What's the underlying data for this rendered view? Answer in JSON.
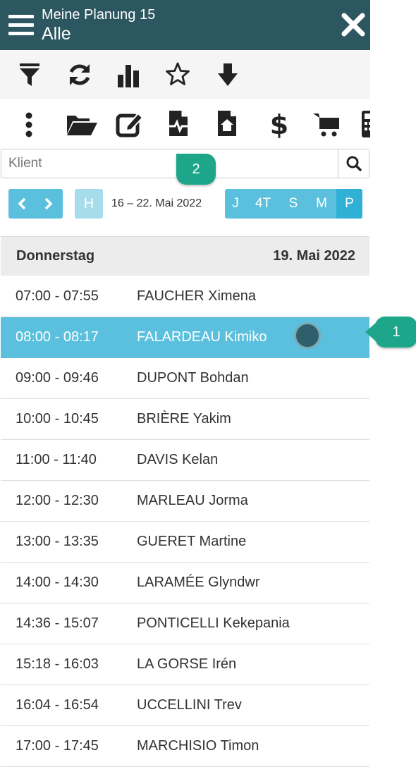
{
  "header": {
    "title": "Meine Planung 15",
    "subtitle": "Alle",
    "bg_color": "#2c5660"
  },
  "toolbar1": {
    "icons": [
      "filter-icon",
      "refresh-icon",
      "bar-chart-icon",
      "star-icon",
      "download-icon"
    ]
  },
  "toolbar2": {
    "icons": [
      "more-vertical-icon",
      "folder-open-icon",
      "edit-icon",
      "file-medical-icon",
      "file-home-icon",
      "dollar-icon",
      "cart-icon",
      "calculator-icon"
    ]
  },
  "search": {
    "placeholder": "Klient"
  },
  "date_nav": {
    "today_label": "H",
    "range": "16 – 22. Mai 2022",
    "views": [
      {
        "label": "J",
        "active": false
      },
      {
        "label": "4T",
        "active": false
      },
      {
        "label": "S",
        "active": false
      },
      {
        "label": "M",
        "active": false
      },
      {
        "label": "P",
        "active": true
      }
    ]
  },
  "day": {
    "name": "Donnerstag",
    "date": "19. Mai 2022"
  },
  "appointments": [
    {
      "time": "07:00 - 07:55",
      "name": "FAUCHER Ximena",
      "selected": false
    },
    {
      "time": "08:00 - 08:17",
      "name": "FALARDEAU Kimiko",
      "selected": true
    },
    {
      "time": "09:00 - 09:46",
      "name": "DUPONT Bohdan",
      "selected": false
    },
    {
      "time": "10:00 - 10:45",
      "name": "BRIÈRE Yakim",
      "selected": false
    },
    {
      "time": "11:00 - 11:40",
      "name": "DAVIS Kelan",
      "selected": false
    },
    {
      "time": "12:00 - 12:30",
      "name": "MARLEAU Jorma",
      "selected": false
    },
    {
      "time": "13:00 - 13:35",
      "name": "GUERET Martine",
      "selected": false
    },
    {
      "time": "14:00 - 14:30",
      "name": "LARAMÉE Glyndwr",
      "selected": false
    },
    {
      "time": "14:36 - 15:07",
      "name": "PONTICELLI Kekepania",
      "selected": false
    },
    {
      "time": "15:18 - 16:03",
      "name": "LA GORSE Irén",
      "selected": false
    },
    {
      "time": "16:04 - 16:54",
      "name": "UCCELLINI Trev",
      "selected": false
    },
    {
      "time": "17:00 - 17:45",
      "name": "MARCHISIO Timon",
      "selected": false
    }
  ],
  "callouts": {
    "one": "1",
    "two": "2"
  },
  "colors": {
    "accent": "#5bc0de",
    "selected_row": "#5bc0de",
    "callout": "#1ea68a"
  }
}
